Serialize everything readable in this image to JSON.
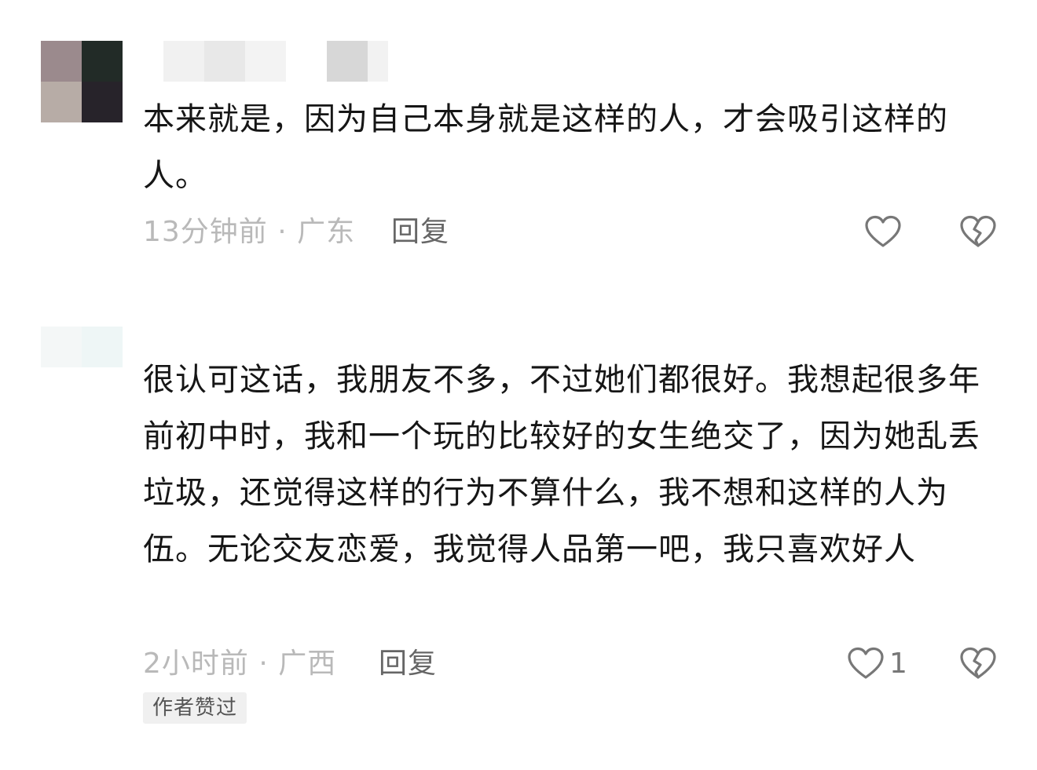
{
  "comments": [
    {
      "avatar_colors": [
        "#9b8a8d",
        "#222b27",
        "#b7aca6",
        "#27232a"
      ],
      "username_blur_colors": [
        "#f1f1f1",
        "#e8e8e8",
        "#f3f3f3",
        "#d7d7d7"
      ],
      "text": "本来就是，因为自己本身就是这样的人，才会吸引这样的人。",
      "time": "13分钟前",
      "location": "广东",
      "reply_label": "回复",
      "like_count": "",
      "author_liked_badge": ""
    },
    {
      "avatar_colors": [
        "#f4f7f7",
        "#eef6f6",
        "#f6f8f8",
        "#f7f9f9"
      ],
      "username_blur_colors": [],
      "text": "很认可这话，我朋友不多，不过她们都很好。我想起很多年前初中时，我和一个玩的比较好的女生绝交了，因为她乱丢垃圾，还觉得这样的行为不算什么，我不想和这样的人为伍。无论交友恋爱，我觉得人品第一吧，我只喜欢好人",
      "time": "2小时前",
      "location": "广西",
      "reply_label": "回复",
      "like_count": "1",
      "author_liked_badge": "作者赞过"
    }
  ],
  "meta_separator": " · ",
  "icons": {
    "like": "heart-outline-icon",
    "dislike": "broken-heart-icon"
  },
  "colors": {
    "meta_text": "#b9b9b9",
    "reply_text": "#666666",
    "icon_stroke": "#777777",
    "badge_bg": "#f0f0f0"
  }
}
